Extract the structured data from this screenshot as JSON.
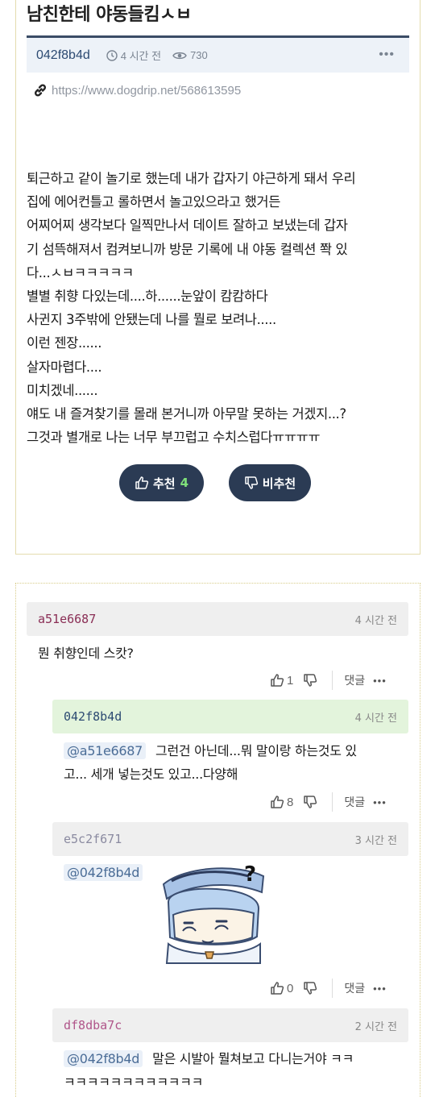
{
  "post": {
    "title": "남친한테 야동들킴ㅅㅂ",
    "author": "042f8b4d",
    "time": "4 시간 전",
    "views": "730",
    "more": "•••",
    "source_url": "https://www.dogdrip.net/568613595",
    "body_lines": [
      "퇴근하고 같이 놀기로 했는데 내가 갑자기 야근하게 돼서 우리",
      "집에 에어컨틀고 롤하면서 놀고있으라고 했거든",
      "어찌어찌 생각보다 일찍만나서 데이트 잘하고 보냈는데 갑자",
      "기 섬뜩해져서 컴켜보니까 방문 기록에 내 야동 컬렉션 쫙 있",
      "다...ㅅㅂㅋㅋㅋㅋㅋ",
      "별별 취향 다있는데....하......눈앞이 캄캄하다",
      "사귄지 3주밖에 안됐는데 나를 뭘로 보려나.....",
      "이런 젠장......",
      "살자마렵다....",
      "미치겠네......",
      "얘도 내 즐겨찾기를 몰래 본거니까 아무말 못하는 거겠지...?",
      "그것과 별개로 나는 너무 부끄럽고 수치스럽다ㅠㅠㅠㅠ"
    ],
    "upvote_label": "추천",
    "upvote_count": "4",
    "downvote_label": "비추천"
  },
  "comments": [
    {
      "author": "a51e6687",
      "time": "4 시간 전",
      "mention": "",
      "lines": [
        "뭔 취향인데 스캇?"
      ],
      "likes": "1",
      "reply_label": "댓글",
      "more": "•••",
      "colors": {
        "header_bg": "#efefef",
        "author": "#8a2e55"
      }
    },
    {
      "author": "042f8b4d",
      "time": "4 시간 전",
      "mention": "@a51e6687",
      "lines": [
        "그런건 아닌데...뭐 말이랑 하는것도 있",
        "고... 세개 넣는것도 있고...다양해"
      ],
      "likes": "8",
      "reply_label": "댓글",
      "more": "•••",
      "colors": {
        "header_bg": "#e3f4dc",
        "author": "#2c4a72"
      }
    },
    {
      "author": "e5c2f671",
      "time": "3 시간 전",
      "mention": "@042f8b4d",
      "lines": [],
      "sticker": "anime-character-sticker",
      "likes": "0",
      "reply_label": "댓글",
      "more": "•••",
      "colors": {
        "header_bg": "#efefef",
        "author": "#8a8aa0"
      }
    },
    {
      "author": "df8dba7c",
      "time": "2 시간 전",
      "mention": "@042f8b4d",
      "lines": [
        "말은 시발아 뭘쳐보고 다니는거야 ㅋㅋ",
        "ㅋㅋㅋㅋㅋㅋㅋㅋㅋㅋㅋㅋ"
      ],
      "colors": {
        "header_bg": "#efefef",
        "author": "#b0558a"
      }
    }
  ]
}
